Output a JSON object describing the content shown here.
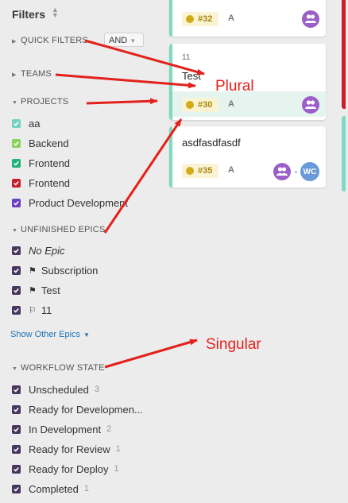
{
  "sidebar": {
    "title": "Filters",
    "sections": {
      "quick_filters": "QUICK FILTERS",
      "teams": "TEAMS",
      "projects": "PROJECTS",
      "unfinished_epics": "UNFINISHED EPICS",
      "workflow_state": "WORKFLOW STATE"
    },
    "and_button": "AND",
    "projects": [
      {
        "label": "aa",
        "color": "#72d1c0"
      },
      {
        "label": "Backend",
        "color": "#89d35c"
      },
      {
        "label": "Frontend",
        "color": "#1fb27a"
      },
      {
        "label": "Frontend",
        "color": "#c4202c"
      },
      {
        "label": "Product Development",
        "color": "#6a3ec2"
      }
    ],
    "epics": [
      {
        "label": "No Epic",
        "icon": "none"
      },
      {
        "label": "Subscription",
        "icon": "flag-icon"
      },
      {
        "label": "Test",
        "icon": "flag-icon"
      },
      {
        "label": "11",
        "icon": "flag-outline-icon"
      }
    ],
    "show_other_epics": "Show Other Epics",
    "workflow_states": [
      {
        "label": "Unscheduled",
        "count": "3"
      },
      {
        "label": "Ready for Developmen...",
        "count": ""
      },
      {
        "label": "In Development",
        "count": "2"
      },
      {
        "label": "Ready for Review",
        "count": "1"
      },
      {
        "label": "Ready for Deploy",
        "count": "1"
      },
      {
        "label": "Completed",
        "count": "1"
      }
    ],
    "checkbox_color": "#47365e"
  },
  "cards": [
    {
      "number": "",
      "title": "",
      "badge": "#32",
      "letter": "A"
    },
    {
      "number": "11",
      "title": "Test",
      "badge": "#30",
      "letter": "A"
    },
    {
      "number": "",
      "title": "asdfasdfasdf",
      "badge": "#35",
      "letter": "A",
      "avatar_initials": "WC"
    }
  ],
  "annotations": {
    "plural": "Plural",
    "singular": "Singular",
    "color": "#e3211c"
  },
  "colors": {
    "card_edge": "#7ed9c2",
    "badge_bg": "#fbf4d4",
    "badge_text": "#a7860b",
    "group_avatar": "#9b5fc7",
    "link": "#1f73b7"
  }
}
